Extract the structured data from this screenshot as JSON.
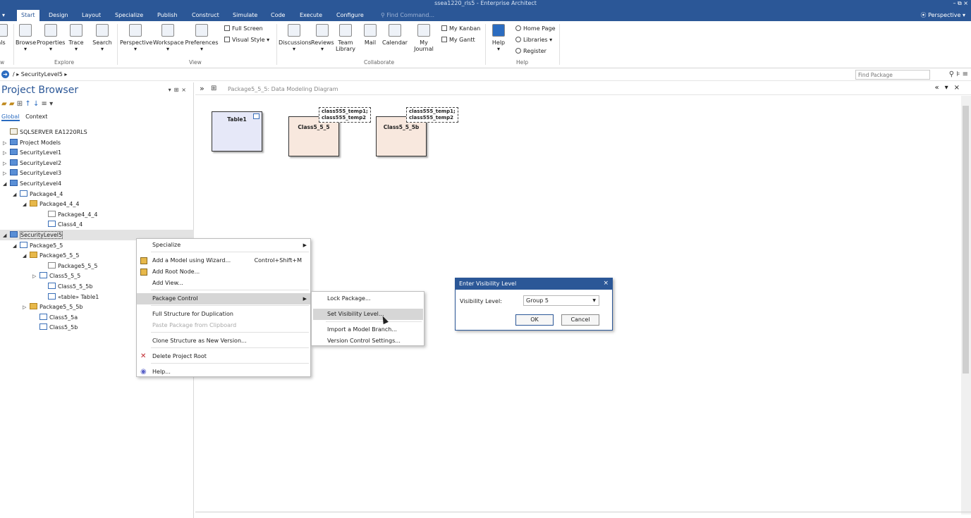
{
  "window": {
    "title": "ssea1220_rls5 - Enterprise Architect",
    "controls": "– ⧉ ×"
  },
  "menu_tabs": [
    "Start",
    "Design",
    "Layout",
    "Specialize",
    "Publish",
    "Construct",
    "Simulate",
    "Code",
    "Execute",
    "Configure"
  ],
  "active_tab": "Start",
  "find_command": "Find Command...",
  "perspective": "Perspective",
  "ribbon": {
    "explore_buttons": [
      "Browse",
      "Properties",
      "Trace",
      "Search"
    ],
    "view_buttons": [
      "Perspective",
      "Workspace",
      "Preferences"
    ],
    "view_small": [
      "Full Screen",
      "Visual Style"
    ],
    "collab_buttons": [
      "Discussions",
      "Reviews",
      "Team Library",
      "Mail",
      "Calendar",
      "My Journal"
    ],
    "collab_small": [
      "My Kanban",
      "My Gantt"
    ],
    "help_button": "Help",
    "help_small": [
      "Home Page",
      "Libraries",
      "Register"
    ],
    "left_cut": "als",
    "groups": [
      "Explore",
      "View",
      "Collaborate",
      "Help"
    ],
    "left_group_cut": "w"
  },
  "breadcrumb": {
    "path": "/  ▸  SecurityLevel5  ▸",
    "find_placeholder": "Find Package"
  },
  "project_browser": {
    "title": "Project Browser",
    "tabs": [
      "Global",
      "Context"
    ],
    "tree": [
      {
        "label": "SQLSERVER EA1220RLS",
        "exp": "",
        "icon": "dbpkg",
        "indent": 0
      },
      {
        "label": "Project Models",
        "exp": "▷",
        "icon": "model",
        "indent": 0
      },
      {
        "label": "SecurityLevel1",
        "exp": "▷",
        "icon": "model",
        "indent": 0
      },
      {
        "label": "SecurityLevel2",
        "exp": "▷",
        "icon": "model",
        "indent": 0
      },
      {
        "label": "SecurityLevel3",
        "exp": "▷",
        "icon": "model",
        "indent": 0
      },
      {
        "label": "SecurityLevel4",
        "exp": "◢",
        "icon": "model",
        "indent": 0
      },
      {
        "label": "Package4_4",
        "exp": "◢",
        "icon": "cls",
        "indent": 1
      },
      {
        "label": "Package4_4_4",
        "exp": "◢",
        "icon": "pkg",
        "indent": 2
      },
      {
        "label": "Package4_4_4",
        "exp": "",
        "icon": "diag",
        "indent": 4
      },
      {
        "label": "Class4_4",
        "exp": "",
        "icon": "cls",
        "indent": 4
      },
      {
        "label": "SecurityLevel5",
        "exp": "◢",
        "icon": "model",
        "indent": 0
      },
      {
        "label": "Package5_5",
        "exp": "◢",
        "icon": "cls",
        "indent": 1
      },
      {
        "label": "Package5_5_5",
        "exp": "◢",
        "icon": "pkg",
        "indent": 2
      },
      {
        "label": "Package5_5_5",
        "exp": "",
        "icon": "diag",
        "indent": 4
      },
      {
        "label": "Class5_5_5",
        "exp": "▷",
        "icon": "cls",
        "indent": 3
      },
      {
        "label": "Class5_5_5b",
        "exp": "",
        "icon": "cls",
        "indent": 4
      },
      {
        "label": "«table» Table1",
        "exp": "",
        "icon": "cls",
        "indent": 4
      },
      {
        "label": "Package5_5_5b",
        "exp": "▷",
        "icon": "pkg",
        "indent": 2
      },
      {
        "label": "Class5_5a",
        "exp": "",
        "icon": "cls",
        "indent": 3
      },
      {
        "label": "Class5_5b",
        "exp": "",
        "icon": "cls",
        "indent": 3
      }
    ]
  },
  "diagram": {
    "tab_title": "Package5_5_5:  Data Modeling Diagram",
    "elements": [
      {
        "name": "Table1",
        "fill": "#e6e8f8"
      },
      {
        "name": "Class5_5_5",
        "fill": "#f8e8de"
      },
      {
        "name": "Class5_5_5b",
        "fill": "#f8e8de"
      }
    ],
    "template_lines": [
      "class555_temp1;",
      "class555_temp2"
    ]
  },
  "context_menu": [
    {
      "label": "Specialize",
      "shortcut": "",
      "submenu": true,
      "disabled": false,
      "icon": ""
    },
    {
      "label": "Add a Model using Wizard...",
      "shortcut": "Control+Shift+M",
      "submenu": false,
      "disabled": false,
      "icon": "wizard"
    },
    {
      "label": "Add Root Node...",
      "shortcut": "",
      "submenu": false,
      "disabled": false,
      "icon": "root"
    },
    {
      "label": "Add View...",
      "shortcut": "",
      "submenu": false,
      "disabled": false,
      "icon": ""
    },
    {
      "label": "Package Control",
      "shortcut": "",
      "submenu": true,
      "disabled": false,
      "icon": ""
    },
    {
      "label": "Full Structure for Duplication",
      "shortcut": "",
      "submenu": false,
      "disabled": false,
      "icon": ""
    },
    {
      "label": "Paste Package from Clipboard",
      "shortcut": "",
      "submenu": false,
      "disabled": true,
      "icon": ""
    },
    {
      "label": "Clone Structure as New Version...",
      "shortcut": "",
      "submenu": false,
      "disabled": false,
      "icon": ""
    },
    {
      "label": "Delete Project Root",
      "shortcut": "",
      "submenu": false,
      "disabled": false,
      "icon": "delete"
    },
    {
      "label": "Help...",
      "shortcut": "",
      "submenu": false,
      "disabled": false,
      "icon": "help"
    }
  ],
  "package_control_submenu": [
    "Lock Package...",
    "Set Visibility Level...",
    "Import a Model Branch...",
    "Version Control Settings..."
  ],
  "dialog": {
    "title": "Enter Visibility Level",
    "label": "Visibility Level:",
    "selected": "Group 5",
    "ok": "OK",
    "cancel": "Cancel"
  },
  "colors": {
    "brand": "#2b5797",
    "accent": "#2b6cc0"
  }
}
